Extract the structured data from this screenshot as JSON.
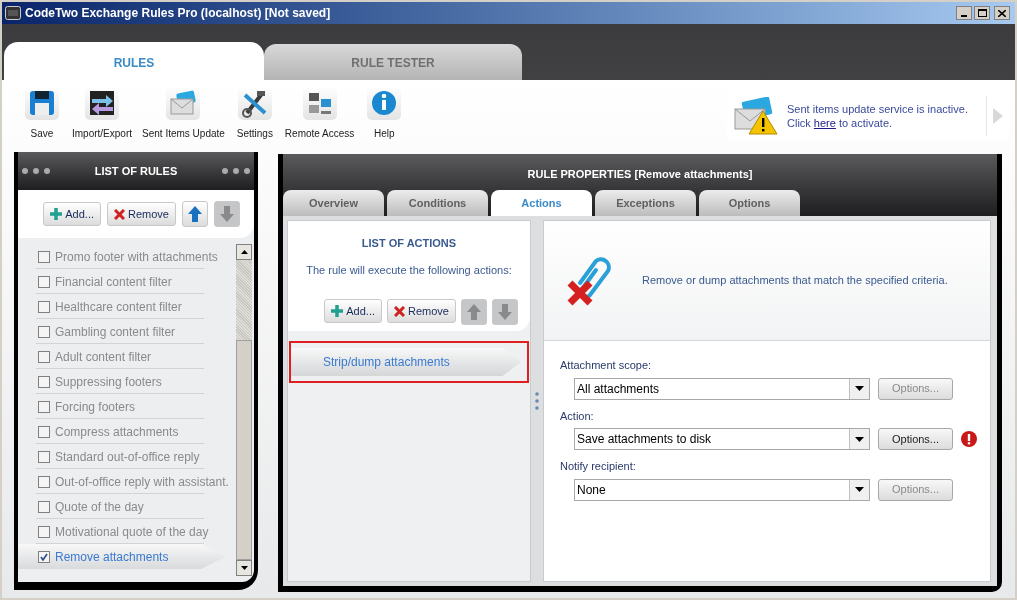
{
  "window": {
    "title": "CodeTwo Exchange Rules Pro (localhost) [Not saved]"
  },
  "main_tabs": [
    {
      "label": "RULES",
      "selected": true
    },
    {
      "label": "RULE TESTER",
      "selected": false
    }
  ],
  "toolbar": [
    {
      "kind": "save",
      "label": "Save"
    },
    {
      "kind": "import_export",
      "label": "Import/Export"
    },
    {
      "kind": "sent_items",
      "label": "Sent Items Update"
    },
    {
      "kind": "settings",
      "label": "Settings"
    },
    {
      "kind": "remote",
      "label": "Remote Access"
    },
    {
      "kind": "help",
      "label": "Help"
    }
  ],
  "notification": {
    "message": "Sent items update service is inactive.",
    "text_before_link": "Click",
    "link": "here",
    "text_after_link": "to activate."
  },
  "rules_panel": {
    "title": "LIST OF RULES",
    "buttons": [
      {
        "kind": "add",
        "label": "Add...",
        "disabled": false
      },
      {
        "kind": "remove",
        "label": "Remove",
        "disabled": false
      },
      {
        "kind": "up",
        "disabled": false
      },
      {
        "kind": "down",
        "disabled": true
      }
    ],
    "rules": [
      {
        "label": "Promo footer with attachments",
        "checked": false,
        "selected": false
      },
      {
        "label": "Financial content filter",
        "checked": false,
        "selected": false
      },
      {
        "label": "Healthcare content filter",
        "checked": false,
        "selected": false
      },
      {
        "label": "Gambling content filter",
        "checked": false,
        "selected": false
      },
      {
        "label": "Adult content filter",
        "checked": false,
        "selected": false
      },
      {
        "label": "Suppressing footers",
        "checked": false,
        "selected": false
      },
      {
        "label": "Forcing footers",
        "checked": false,
        "selected": false
      },
      {
        "label": "Compress attachments",
        "checked": false,
        "selected": false
      },
      {
        "label": "Standard out-of-office reply",
        "checked": false,
        "selected": false
      },
      {
        "label": "Out-of-office reply with assistant.",
        "checked": false,
        "selected": false
      },
      {
        "label": "Quote of the day",
        "checked": false,
        "selected": false
      },
      {
        "label": "Motivational quote of the day",
        "checked": false,
        "selected": false
      },
      {
        "label": "Remove attachments",
        "checked": true,
        "selected": true
      }
    ]
  },
  "properties": {
    "title": "RULE PROPERTIES [Remove attachments]",
    "tabs": [
      {
        "label": "Overview",
        "selected": false
      },
      {
        "label": "Conditions",
        "selected": false
      },
      {
        "label": "Actions",
        "selected": true
      },
      {
        "label": "Exceptions",
        "selected": false
      },
      {
        "label": "Options",
        "selected": false
      }
    ],
    "actions_list": {
      "title": "LIST OF ACTIONS",
      "subtitle": "The rule will execute the following actions:",
      "buttons": [
        {
          "kind": "add",
          "label": "Add...",
          "disabled": false
        },
        {
          "kind": "remove",
          "label": "Remove",
          "disabled": false
        },
        {
          "kind": "up",
          "disabled": true
        },
        {
          "kind": "down",
          "disabled": true
        }
      ],
      "actions": [
        {
          "label": "Strip/dump attachments",
          "selected": true
        }
      ]
    },
    "description": "Remove or dump attachments that match the specified criteria.",
    "fields": [
      {
        "label": "Attachment scope:",
        "value": "All attachments",
        "options_label": "Options...",
        "options_disabled": true,
        "error": false
      },
      {
        "label": "Action:",
        "value": "Save attachments to disk",
        "options_label": "Options...",
        "options_disabled": false,
        "error": true
      },
      {
        "label": "Notify recipient:",
        "value": "None",
        "options_label": "Options...",
        "options_disabled": true,
        "error": false
      }
    ]
  }
}
